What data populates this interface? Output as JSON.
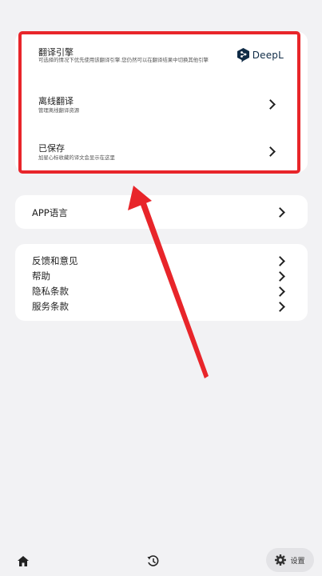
{
  "translation_card": {
    "engine": {
      "title": "翻译引擎",
      "desc": "可选择的情况下优先使用该翻译引擎.您仍然可以在翻译结果中切换其他引擎",
      "brand": "DeepL"
    },
    "offline": {
      "title": "离线翻译",
      "desc": "管理离线翻译资源"
    },
    "saved": {
      "title": "已保存",
      "desc": "加星心标收藏的译文会显示在这里"
    }
  },
  "language_card": {
    "label": "APP语言"
  },
  "more_card": {
    "items": [
      "反馈和意见",
      "帮助",
      "隐私条款",
      "服务条款"
    ]
  },
  "bottom_nav": {
    "home_icon": "home-icon",
    "history_icon": "history-icon",
    "settings_icon": "gear-icon",
    "settings_label": "设置"
  },
  "colors": {
    "highlight": "#e8252a",
    "background": "#f2f2f4",
    "card": "#ffffff",
    "deepl_brand": "#0f2b46"
  }
}
